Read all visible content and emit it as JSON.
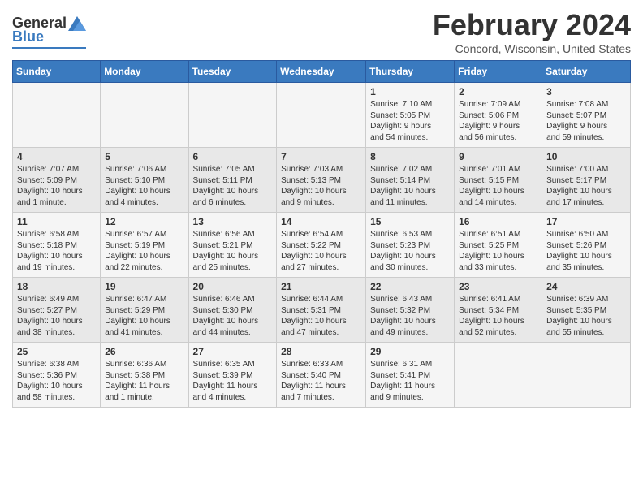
{
  "header": {
    "logo_general": "General",
    "logo_blue": "Blue",
    "title": "February 2024",
    "subtitle": "Concord, Wisconsin, United States"
  },
  "calendar": {
    "days_of_week": [
      "Sunday",
      "Monday",
      "Tuesday",
      "Wednesday",
      "Thursday",
      "Friday",
      "Saturday"
    ],
    "weeks": [
      [
        {
          "num": "",
          "info": ""
        },
        {
          "num": "",
          "info": ""
        },
        {
          "num": "",
          "info": ""
        },
        {
          "num": "",
          "info": ""
        },
        {
          "num": "1",
          "info": "Sunrise: 7:10 AM\nSunset: 5:05 PM\nDaylight: 9 hours\nand 54 minutes."
        },
        {
          "num": "2",
          "info": "Sunrise: 7:09 AM\nSunset: 5:06 PM\nDaylight: 9 hours\nand 56 minutes."
        },
        {
          "num": "3",
          "info": "Sunrise: 7:08 AM\nSunset: 5:07 PM\nDaylight: 9 hours\nand 59 minutes."
        }
      ],
      [
        {
          "num": "4",
          "info": "Sunrise: 7:07 AM\nSunset: 5:09 PM\nDaylight: 10 hours\nand 1 minute."
        },
        {
          "num": "5",
          "info": "Sunrise: 7:06 AM\nSunset: 5:10 PM\nDaylight: 10 hours\nand 4 minutes."
        },
        {
          "num": "6",
          "info": "Sunrise: 7:05 AM\nSunset: 5:11 PM\nDaylight: 10 hours\nand 6 minutes."
        },
        {
          "num": "7",
          "info": "Sunrise: 7:03 AM\nSunset: 5:13 PM\nDaylight: 10 hours\nand 9 minutes."
        },
        {
          "num": "8",
          "info": "Sunrise: 7:02 AM\nSunset: 5:14 PM\nDaylight: 10 hours\nand 11 minutes."
        },
        {
          "num": "9",
          "info": "Sunrise: 7:01 AM\nSunset: 5:15 PM\nDaylight: 10 hours\nand 14 minutes."
        },
        {
          "num": "10",
          "info": "Sunrise: 7:00 AM\nSunset: 5:17 PM\nDaylight: 10 hours\nand 17 minutes."
        }
      ],
      [
        {
          "num": "11",
          "info": "Sunrise: 6:58 AM\nSunset: 5:18 PM\nDaylight: 10 hours\nand 19 minutes."
        },
        {
          "num": "12",
          "info": "Sunrise: 6:57 AM\nSunset: 5:19 PM\nDaylight: 10 hours\nand 22 minutes."
        },
        {
          "num": "13",
          "info": "Sunrise: 6:56 AM\nSunset: 5:21 PM\nDaylight: 10 hours\nand 25 minutes."
        },
        {
          "num": "14",
          "info": "Sunrise: 6:54 AM\nSunset: 5:22 PM\nDaylight: 10 hours\nand 27 minutes."
        },
        {
          "num": "15",
          "info": "Sunrise: 6:53 AM\nSunset: 5:23 PM\nDaylight: 10 hours\nand 30 minutes."
        },
        {
          "num": "16",
          "info": "Sunrise: 6:51 AM\nSunset: 5:25 PM\nDaylight: 10 hours\nand 33 minutes."
        },
        {
          "num": "17",
          "info": "Sunrise: 6:50 AM\nSunset: 5:26 PM\nDaylight: 10 hours\nand 35 minutes."
        }
      ],
      [
        {
          "num": "18",
          "info": "Sunrise: 6:49 AM\nSunset: 5:27 PM\nDaylight: 10 hours\nand 38 minutes."
        },
        {
          "num": "19",
          "info": "Sunrise: 6:47 AM\nSunset: 5:29 PM\nDaylight: 10 hours\nand 41 minutes."
        },
        {
          "num": "20",
          "info": "Sunrise: 6:46 AM\nSunset: 5:30 PM\nDaylight: 10 hours\nand 44 minutes."
        },
        {
          "num": "21",
          "info": "Sunrise: 6:44 AM\nSunset: 5:31 PM\nDaylight: 10 hours\nand 47 minutes."
        },
        {
          "num": "22",
          "info": "Sunrise: 6:43 AM\nSunset: 5:32 PM\nDaylight: 10 hours\nand 49 minutes."
        },
        {
          "num": "23",
          "info": "Sunrise: 6:41 AM\nSunset: 5:34 PM\nDaylight: 10 hours\nand 52 minutes."
        },
        {
          "num": "24",
          "info": "Sunrise: 6:39 AM\nSunset: 5:35 PM\nDaylight: 10 hours\nand 55 minutes."
        }
      ],
      [
        {
          "num": "25",
          "info": "Sunrise: 6:38 AM\nSunset: 5:36 PM\nDaylight: 10 hours\nand 58 minutes."
        },
        {
          "num": "26",
          "info": "Sunrise: 6:36 AM\nSunset: 5:38 PM\nDaylight: 11 hours\nand 1 minute."
        },
        {
          "num": "27",
          "info": "Sunrise: 6:35 AM\nSunset: 5:39 PM\nDaylight: 11 hours\nand 4 minutes."
        },
        {
          "num": "28",
          "info": "Sunrise: 6:33 AM\nSunset: 5:40 PM\nDaylight: 11 hours\nand 7 minutes."
        },
        {
          "num": "29",
          "info": "Sunrise: 6:31 AM\nSunset: 5:41 PM\nDaylight: 11 hours\nand 9 minutes."
        },
        {
          "num": "",
          "info": ""
        },
        {
          "num": "",
          "info": ""
        }
      ]
    ]
  }
}
